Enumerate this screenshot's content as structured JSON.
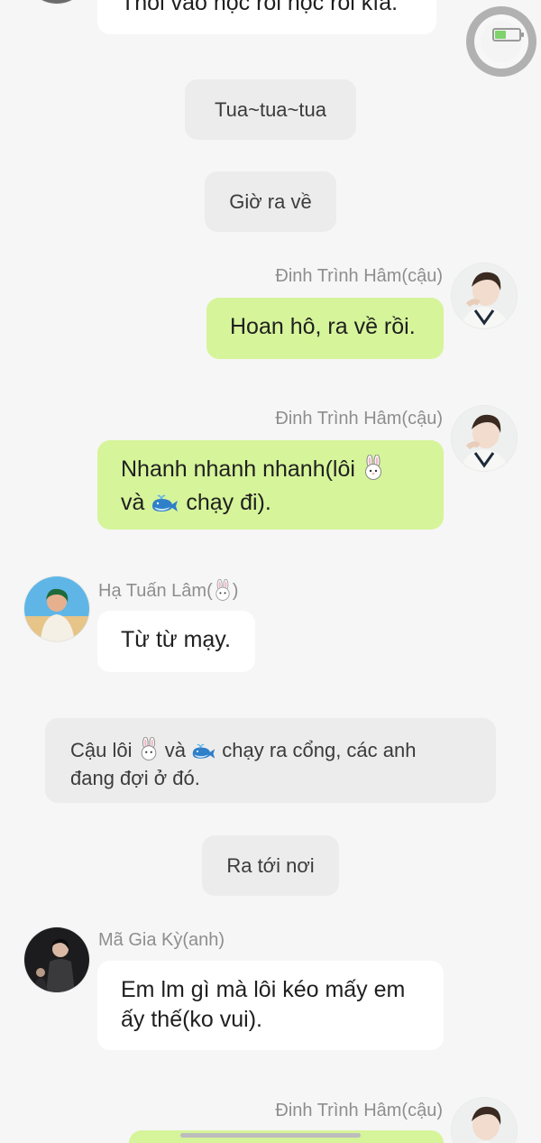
{
  "messages": {
    "top_partial": "Thôi vào học rồi học rồi kìa.",
    "system_tua": "Tua~tua~tua",
    "system_gio_ra_ve": "Giờ ra về",
    "dinh_1": {
      "sender": "Đinh Trình Hâm(cậu)",
      "text": "Hoan hô, ra về rồi."
    },
    "dinh_2": {
      "sender": "Đinh Trình Hâm(cậu)",
      "line1": "Nhanh nhanh nhanh(lôi",
      "line2_a": "và",
      "line2_b": "chạy đi)."
    },
    "ha_tuan_lam": {
      "sender_prefix": "Hạ Tuấn Lâm(",
      "sender_suffix": ")",
      "text": "Từ từ mạy."
    },
    "system_cong": {
      "part1": "Cậu lôi",
      "part2": "và",
      "part3": "chạy ra cổng, các anh",
      "line2": "đang đợi ở đó."
    },
    "system_ra_toi_noi": "Ra tới nơi",
    "ma_gia_ky": {
      "sender": "Mã Gia Kỳ(anh)",
      "text": "Em lm gì mà lôi kéo mấy em ấy thế(ko vui)."
    },
    "dinh_3": {
      "sender": "Đinh Trình Hâm(cậu)"
    }
  },
  "icons": {
    "rabbit": "rabbit-icon",
    "whale": "whale-icon",
    "battery": "battery-icon"
  },
  "colors": {
    "background": "#f6f6f6",
    "bubble_green": "#d6f49a",
    "bubble_white": "#ffffff",
    "system_bg": "#ececec",
    "sender_text": "#8e8e8e"
  }
}
